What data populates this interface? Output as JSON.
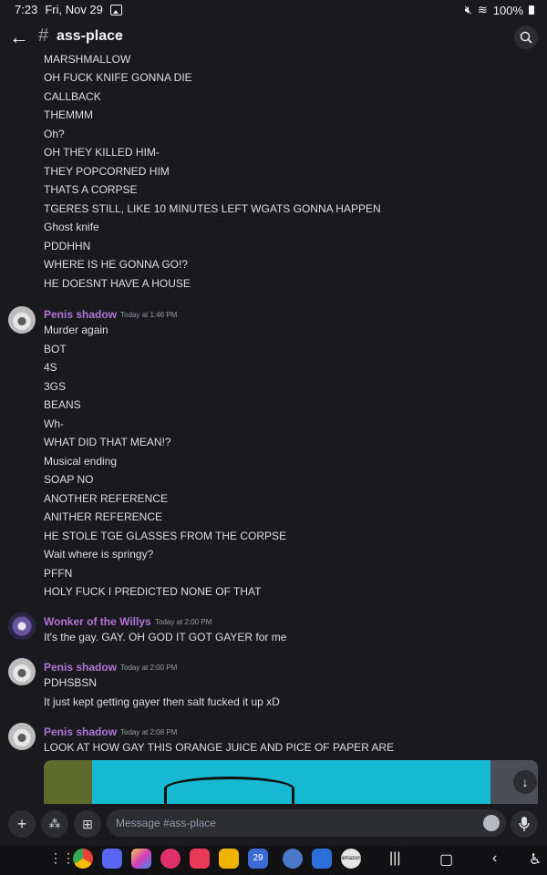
{
  "status_bar": {
    "time": "7:23",
    "date": "Fri, Nov 29",
    "battery": "100%"
  },
  "header": {
    "channel": "ass-place"
  },
  "feed": {
    "continuation_lines": [
      "MARSHMALLOW",
      "OH FUCK KNIFE GONNA DIE",
      "CALLBACK",
      "THEMMM",
      "Oh?",
      "OH THEY KILLED HIM-",
      "THEY POPCORNED HIM",
      "THATS A CORPSE",
      "TGERES STILL, LIKE 10 MINUTES LEFT WGATS GONNA HAPPEN",
      "Ghost knife",
      "PDDHHN",
      "WHERE IS HE GONNA GO!?",
      "HE DOESNT HAVE A HOUSE"
    ],
    "groups": [
      {
        "author": "Penis shadow",
        "timestamp": "Today at 1:46 PM",
        "lines": [
          "Murder again",
          "BOT",
          "4S",
          "3GS",
          "BEANS",
          "Wh-",
          "WHAT DID THAT MEAN!?",
          "Musical ending",
          "SOAP NO",
          "ANOTHER REFERENCE",
          "ANITHER REFERENCE",
          "HE STOLE TGE GLASSES FROM THE CORPSE",
          "Wait where is springy?",
          "PFFN",
          "HOLY FUCK I PREDICTED NONE OF THAT"
        ]
      },
      {
        "author": "Wonker of the Willys",
        "timestamp": "Today at 2:00 PM",
        "lines": [
          "It's the gay. GAY. OH GOD IT GOT GAYER for me"
        ]
      },
      {
        "author": "Penis shadow",
        "timestamp": "Today at 2:00 PM",
        "lines": [
          "PDHSBSN",
          "It just kept getting gayer then salt fucked it up xD"
        ]
      },
      {
        "author": "Penis shadow",
        "timestamp": "Today at 2:08 PM",
        "lines": [
          "LOOK AT HOW GAY THIS ORANGE JUICE AND PICE OF PAPER ARE"
        ]
      }
    ]
  },
  "composer": {
    "placeholder": "Message #ass-place"
  },
  "navbar": {
    "calendar_day": "29",
    "amazon_label": "amazon"
  },
  "colors": {
    "background": "#1a1a1e",
    "author": "#b173d8",
    "text": "#dbdee1",
    "muted": "#949ba4"
  }
}
